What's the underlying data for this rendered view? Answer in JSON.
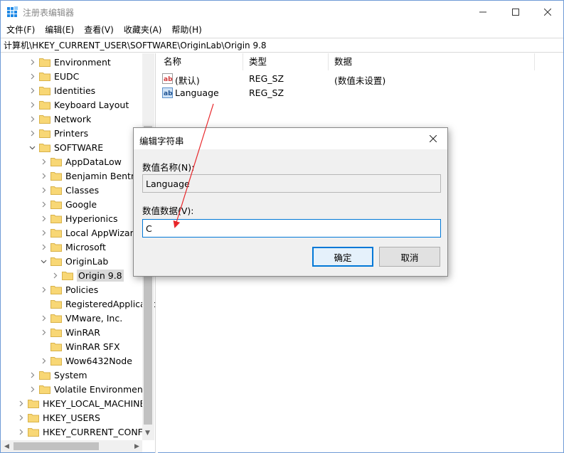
{
  "window": {
    "title": "注册表编辑器",
    "controls": {
      "minimize": "minimize-icon",
      "maximize": "maximize-icon",
      "close": "close-icon"
    }
  },
  "menu": [
    "文件(F)",
    "编辑(E)",
    "查看(V)",
    "收藏夹(A)",
    "帮助(H)"
  ],
  "address": "计算机\\HKEY_CURRENT_USER\\SOFTWARE\\OriginLab\\Origin 9.8",
  "tree": [
    {
      "label": "Environment",
      "level": 1,
      "expander": "collapsed"
    },
    {
      "label": "EUDC",
      "level": 1,
      "expander": "collapsed"
    },
    {
      "label": "Identities",
      "level": 1,
      "expander": "collapsed"
    },
    {
      "label": "Keyboard Layout",
      "level": 1,
      "expander": "collapsed"
    },
    {
      "label": "Network",
      "level": 1,
      "expander": "collapsed"
    },
    {
      "label": "Printers",
      "level": 1,
      "expander": "collapsed"
    },
    {
      "label": "SOFTWARE",
      "level": 1,
      "expander": "expanded"
    },
    {
      "label": "AppDataLow",
      "level": 2,
      "expander": "collapsed"
    },
    {
      "label": "Benjamin Bentmann",
      "level": 2,
      "expander": "collapsed"
    },
    {
      "label": "Classes",
      "level": 2,
      "expander": "collapsed"
    },
    {
      "label": "Google",
      "level": 2,
      "expander": "collapsed"
    },
    {
      "label": "Hyperionics",
      "level": 2,
      "expander": "collapsed"
    },
    {
      "label": "Local AppWizard-Generated",
      "level": 2,
      "expander": "collapsed"
    },
    {
      "label": "Microsoft",
      "level": 2,
      "expander": "collapsed"
    },
    {
      "label": "OriginLab",
      "level": 2,
      "expander": "expanded"
    },
    {
      "label": "Origin 9.8",
      "level": 3,
      "expander": "collapsed",
      "selected": true
    },
    {
      "label": "Policies",
      "level": 2,
      "expander": "collapsed"
    },
    {
      "label": "RegisteredApplications",
      "level": 2,
      "expander": "none"
    },
    {
      "label": "VMware, Inc.",
      "level": 2,
      "expander": "collapsed"
    },
    {
      "label": "WinRAR",
      "level": 2,
      "expander": "collapsed"
    },
    {
      "label": "WinRAR SFX",
      "level": 2,
      "expander": "none"
    },
    {
      "label": "Wow6432Node",
      "level": 2,
      "expander": "collapsed"
    },
    {
      "label": "System",
      "level": 1,
      "expander": "collapsed"
    },
    {
      "label": "Volatile Environment",
      "level": 1,
      "expander": "collapsed"
    },
    {
      "label": "HKEY_LOCAL_MACHINE",
      "level": 0,
      "expander": "collapsed"
    },
    {
      "label": "HKEY_USERS",
      "level": 0,
      "expander": "collapsed"
    },
    {
      "label": "HKEY_CURRENT_CONFIG",
      "level": 0,
      "expander": "collapsed"
    }
  ],
  "list": {
    "columns": [
      "名称",
      "类型",
      "数据"
    ],
    "rows": [
      {
        "name": "(默认)",
        "type": "REG_SZ",
        "data": "(数值未设置)",
        "icon": "string-value-icon"
      },
      {
        "name": "Language",
        "type": "REG_SZ",
        "data": "",
        "icon": "string-value-icon"
      }
    ]
  },
  "dialog": {
    "title": "编辑字符串",
    "name_label": "数值名称(N):",
    "name_value": "Language",
    "data_label": "数值数据(V):",
    "data_value": "C",
    "ok_label": "确定",
    "cancel_label": "取消"
  },
  "colors": {
    "accent": "#0078d7",
    "annotation_arrow": "#e8262a",
    "folder": "#f8d775",
    "selected_row": "#d9d9d9"
  }
}
